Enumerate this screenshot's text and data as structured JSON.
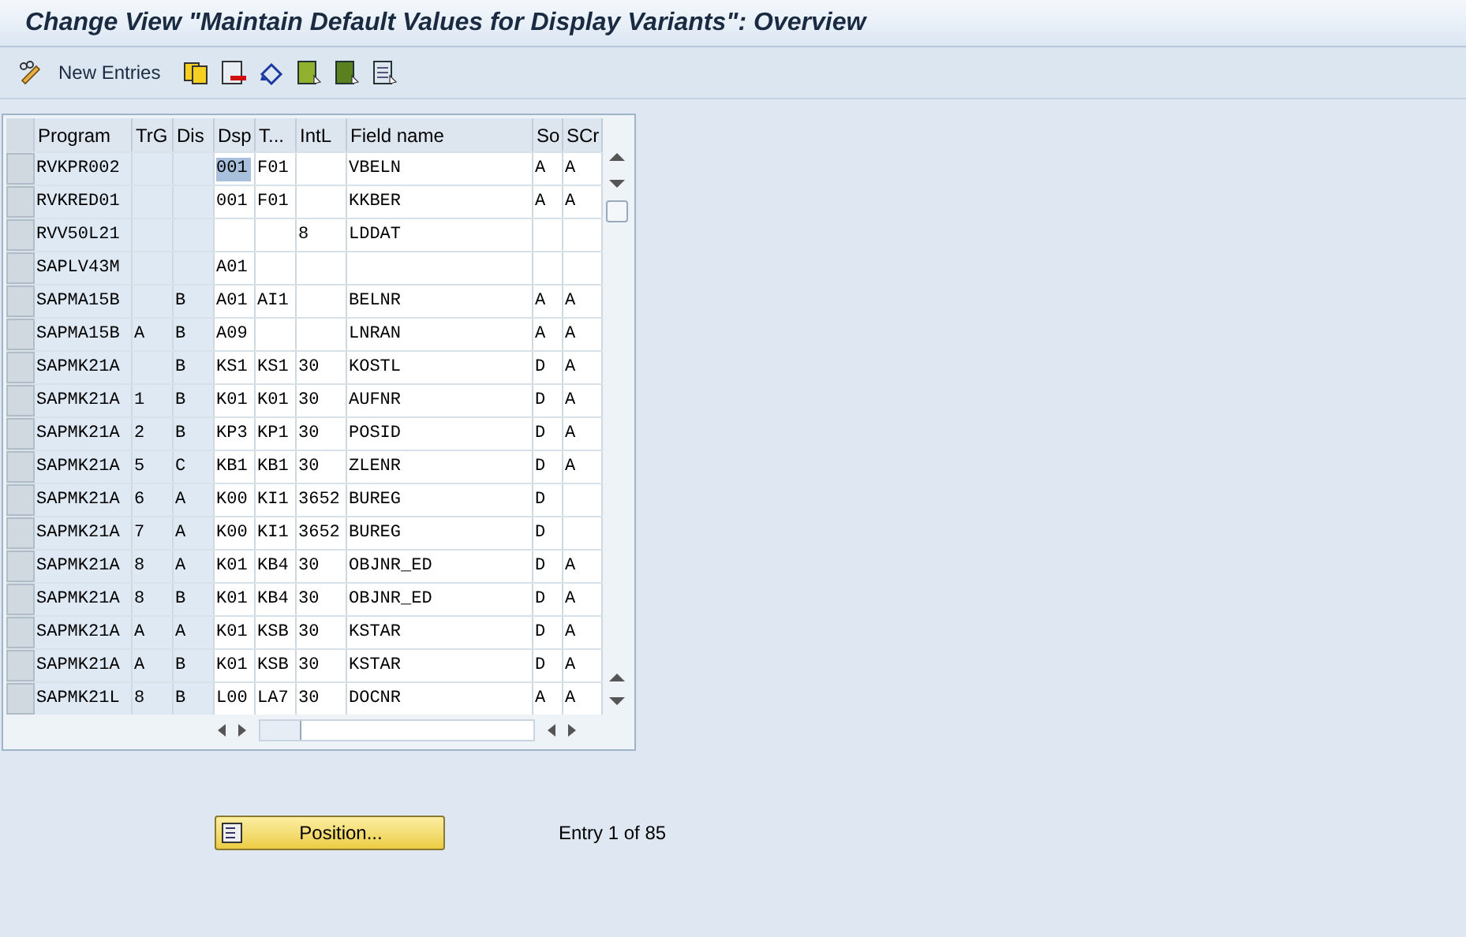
{
  "window": {
    "title": "Change View \"Maintain Default Values for Display Variants\": Overview"
  },
  "toolbar": {
    "new_entries": "New Entries"
  },
  "table": {
    "columns": [
      "Program",
      "TrG",
      "Dis",
      "Dsp",
      "T...",
      "IntL",
      "Field name",
      "So",
      "SCr"
    ],
    "rows": [
      {
        "cells": [
          "RVKPR002",
          "",
          "",
          "001",
          "F01",
          "",
          "VBELN",
          "A",
          "A"
        ],
        "cursor": true
      },
      {
        "cells": [
          "RVKRED01",
          "",
          "",
          "001",
          "F01",
          "",
          "KKBER",
          "A",
          "A"
        ],
        "cursor": false
      },
      {
        "cells": [
          "RVV50L21",
          "",
          "",
          "",
          "",
          "8",
          "LDDAT",
          "",
          ""
        ],
        "cursor": false
      },
      {
        "cells": [
          "SAPLV43M",
          "",
          "",
          "A01",
          "",
          "",
          "",
          "",
          ""
        ],
        "cursor": false
      },
      {
        "cells": [
          "SAPMA15B",
          "",
          "B",
          "A01",
          "AI1",
          "",
          "BELNR",
          "A",
          "A"
        ],
        "cursor": false
      },
      {
        "cells": [
          "SAPMA15B",
          "A",
          "B",
          "A09",
          "",
          "",
          "LNRAN",
          "A",
          "A"
        ],
        "cursor": false
      },
      {
        "cells": [
          "SAPMK21A",
          "",
          "B",
          "KS1",
          "KS1",
          "30",
          "KOSTL",
          "D",
          "A"
        ],
        "cursor": false
      },
      {
        "cells": [
          "SAPMK21A",
          "1",
          "B",
          "K01",
          "K01",
          "30",
          "AUFNR",
          "D",
          "A"
        ],
        "cursor": false
      },
      {
        "cells": [
          "SAPMK21A",
          "2",
          "B",
          "KP3",
          "KP1",
          "30",
          "POSID",
          "D",
          "A"
        ],
        "cursor": false
      },
      {
        "cells": [
          "SAPMK21A",
          "5",
          "C",
          "KB1",
          "KB1",
          "30",
          "ZLENR",
          "D",
          "A"
        ],
        "cursor": false
      },
      {
        "cells": [
          "SAPMK21A",
          "6",
          "A",
          "K00",
          "KI1",
          "3652",
          "BUREG",
          "D",
          ""
        ],
        "cursor": false
      },
      {
        "cells": [
          "SAPMK21A",
          "7",
          "A",
          "K00",
          "KI1",
          "3652",
          "BUREG",
          "D",
          ""
        ],
        "cursor": false
      },
      {
        "cells": [
          "SAPMK21A",
          "8",
          "A",
          "K01",
          "KB4",
          "30",
          "OBJNR_ED",
          "D",
          "A"
        ],
        "cursor": false
      },
      {
        "cells": [
          "SAPMK21A",
          "8",
          "B",
          "K01",
          "KB4",
          "30",
          "OBJNR_ED",
          "D",
          "A"
        ],
        "cursor": false
      },
      {
        "cells": [
          "SAPMK21A",
          "A",
          "A",
          "K01",
          "KSB",
          "30",
          "KSTAR",
          "D",
          "A"
        ],
        "cursor": false
      },
      {
        "cells": [
          "SAPMK21A",
          "A",
          "B",
          "K01",
          "KSB",
          "30",
          "KSTAR",
          "D",
          "A"
        ],
        "cursor": false
      },
      {
        "cells": [
          "SAPMK21L",
          "8",
          "B",
          "L00",
          "LA7",
          "30",
          "DOCNR",
          "A",
          "A"
        ],
        "cursor": false
      }
    ]
  },
  "position_button": "Position...",
  "entry_count": "Entry 1 of 85"
}
